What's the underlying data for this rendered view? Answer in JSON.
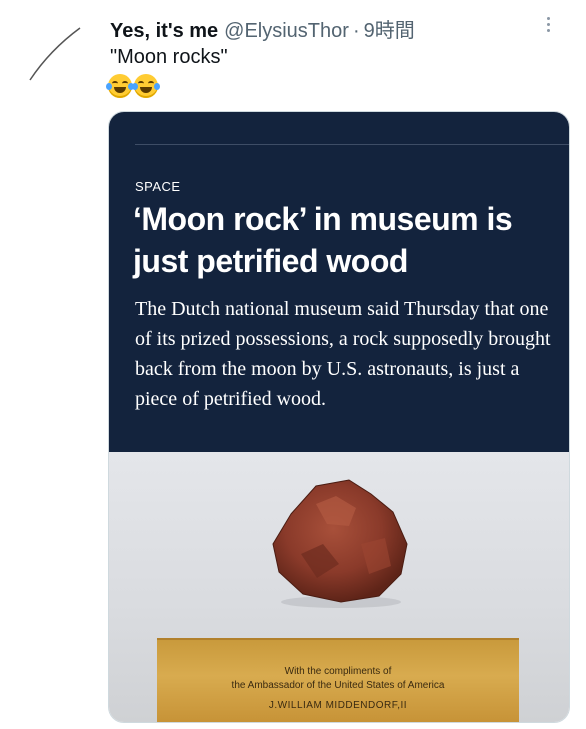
{
  "tweet": {
    "display_name": "Yes, it's me",
    "handle": "@ElysiusThor",
    "separator": "·",
    "time": "9時間",
    "text": "\"Moon rocks\"",
    "emojis": [
      "face-with-tears-of-joy",
      "face-with-tears-of-joy"
    ]
  },
  "card": {
    "kicker": "SPACE",
    "headline": "‘Moon rock’ in museum is just petrified wood",
    "dek": "The Dutch national museum said Thursday that one of its prized possessions, a rock supposedly brought back from the moon by U.S. astronauts, is just a piece of petrified wood.",
    "plaque": {
      "line1": "With the compliments of",
      "line2": "the Ambassador of the United States of America",
      "line3": "J.WILLIAM MIDDENDORF,II"
    }
  },
  "colors": {
    "card_background": "#13233d",
    "plaque": "#d8ab4f",
    "rock": "#8a3a2a"
  }
}
